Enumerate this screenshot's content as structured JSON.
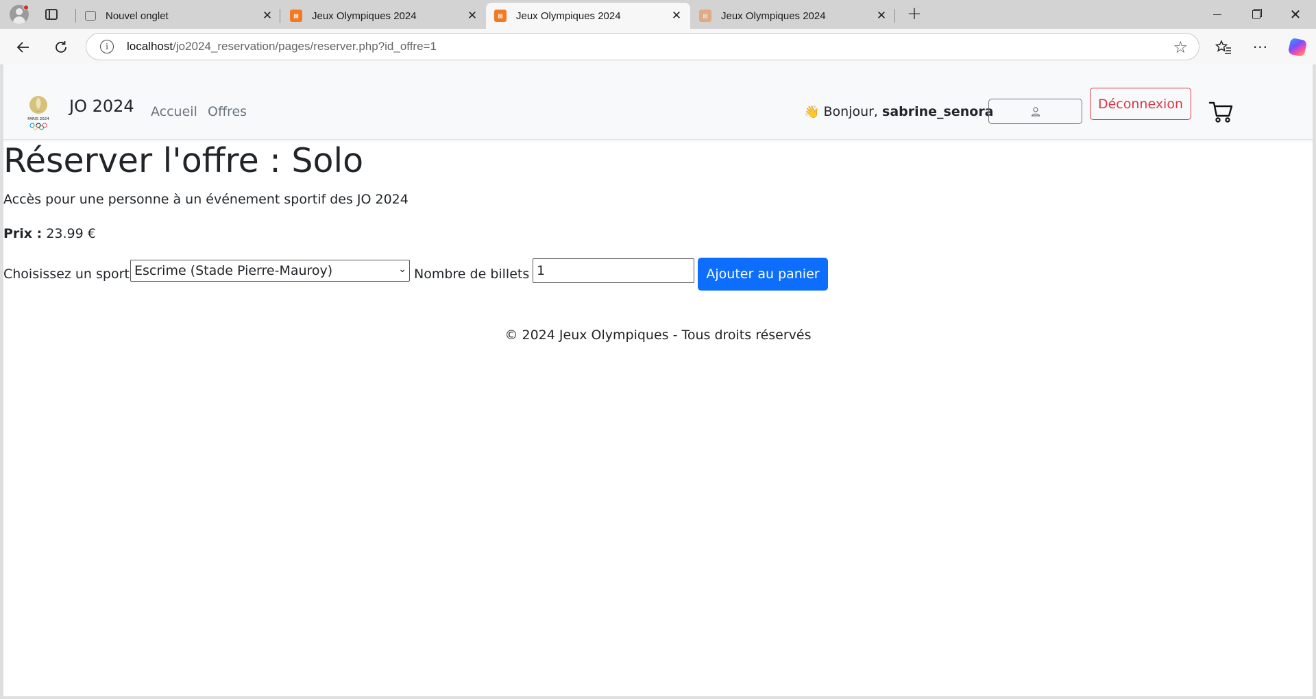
{
  "browser": {
    "tabs": [
      {
        "title": "Nouvel onglet",
        "favicon": "new-tab-icon",
        "active": false
      },
      {
        "title": "Jeux Olympiques 2024",
        "favicon": "xampp-icon",
        "active": false
      },
      {
        "title": "Jeux Olympiques 2024",
        "favicon": "xampp-icon",
        "active": true
      },
      {
        "title": "Jeux Olympiques 2024",
        "favicon": "xampp-icon",
        "active": false
      }
    ],
    "url_host": "localhost",
    "url_path": "/jo2024_reservation/pages/reserver.php?id_offre=1"
  },
  "navbar": {
    "brand": "JO 2024",
    "links": [
      "Accueil",
      "Offres"
    ],
    "greeting_prefix": "Bonjour,",
    "username": "sabrine_senora",
    "logout_label": "Déconnexion",
    "logo_text": "PARIS 2024"
  },
  "offer": {
    "title": "Réserver l'offre : Solo",
    "description": "Accès pour une personne à un événement sportif des JO 2024",
    "price_label": "Prix :",
    "price_value": "23.99 €"
  },
  "form": {
    "sport_label": "Choisissez un sport :",
    "sport_selected": "Escrime (Stade Pierre-Mauroy)",
    "quantity_label": "Nombre de billets :",
    "quantity_value": "1",
    "submit_label": "Ajouter au panier"
  },
  "footer": {
    "text": "© 2024 Jeux Olympiques - Tous droits réservés"
  },
  "colors": {
    "primary": "#0d6efd",
    "danger": "#dc3545",
    "muted": "#6c757d",
    "navbar_bg": "#f8f9fa"
  }
}
